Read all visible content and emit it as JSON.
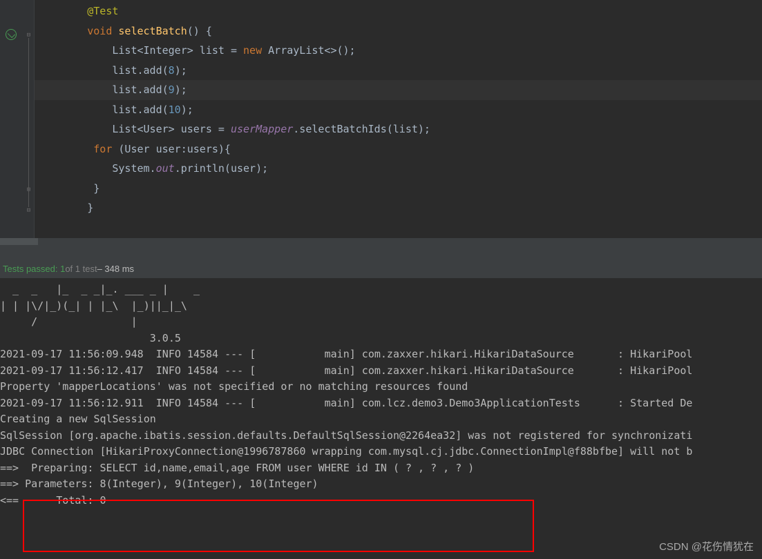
{
  "code": {
    "l1": "        @Test",
    "l2_kw": "        void ",
    "l2_method": "selectBatch",
    "l2_rest": "() {",
    "l3_a": "            List<Integer> list = ",
    "l3_kw": "new ",
    "l3_b": "ArrayList<>();",
    "l4_a": "            list.add(",
    "l4_n": "8",
    "l4_b": ");",
    "l5_a": "            list.add(",
    "l5_n": "9",
    "l5_b": ");",
    "l6_a": "            list.add(",
    "l6_n": "10",
    "l6_b": ");",
    "l7_a": "            List<User> users = ",
    "l7_f": "userMapper",
    "l7_b": ".selectBatchIds(list);",
    "l8_a": "         ",
    "l8_kw": "for ",
    "l8_b": "(User user:users){",
    "l9_a": "            System.",
    "l9_s": "out",
    "l9_b": ".println(user);",
    "l10": "         }",
    "l11": "        }"
  },
  "status": {
    "tests_passed": "Tests passed: 1",
    "of_tests": " of 1 test",
    "duration": " – 348 ms"
  },
  "console": {
    "l1": "  _  _   |_  _ _|_. ___ _ |    _ ",
    "l2": "| | |\\/|_)(_| | |_\\  |_)||_|_\\ ",
    "l3": "     /               |         ",
    "l4": "                        3.0.5 ",
    "l5": "2021-09-17 11:56:09.948  INFO 14584 --- [           main] com.zaxxer.hikari.HikariDataSource       : HikariPool",
    "l6": "2021-09-17 11:56:12.417  INFO 14584 --- [           main] com.zaxxer.hikari.HikariDataSource       : HikariPool",
    "l7": "Property 'mapperLocations' was not specified or no matching resources found",
    "l8": "2021-09-17 11:56:12.911  INFO 14584 --- [           main] com.lcz.demo3.Demo3ApplicationTests      : Started De",
    "l9": "",
    "l10": "Creating a new SqlSession",
    "l11": "SqlSession [org.apache.ibatis.session.defaults.DefaultSqlSession@2264ea32] was not registered for synchronizati",
    "l12": "JDBC Connection [HikariProxyConnection@1996787860 wrapping com.mysql.cj.jdbc.ConnectionImpl@f88bfbe] will not b",
    "l13": "==>  Preparing: SELECT id,name,email,age FROM user WHERE id IN ( ? , ? , ? )",
    "l14": "==> Parameters: 8(Integer), 9(Integer), 10(Integer)",
    "l15": "<==      Total: 0"
  },
  "watermark": "CSDN @花伤情犹在"
}
